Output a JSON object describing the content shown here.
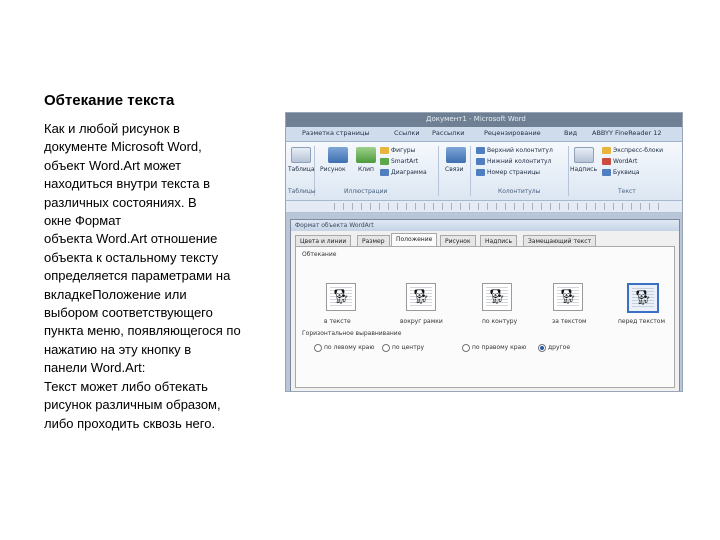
{
  "slide": {
    "title": "Обтекание текста",
    "body_lines": [
      "Как и любой рисунок в",
      "документе Microsoft Word,",
      "объект Word.Art может",
      "находиться внутри текста в",
      "различных состояниях. В",
      "окне Формат",
      "объекта Word.Art отношение",
      "объекта к остальному тексту",
      "определяется параметрами на",
      "вкладкеПоложение или",
      "выбором соответствующего",
      "пункта меню, появляющегося по",
      "нажатию на эту кнопку в",
      "панели Word.Art:",
      "Текст может либо обтекать",
      "рисунок различным образом,",
      "либо проходить сквозь него."
    ]
  },
  "screenshot": {
    "window_title": "Документ1 - Microsoft Word",
    "ribbon_tabs": [
      "Разметка страницы",
      "Ссылки",
      "Рассылки",
      "Рецензирование",
      "Вид",
      "ABBYY FineReader 12"
    ],
    "ribbon": {
      "table_label": "Таблица",
      "picture_label": "Рисунок",
      "clip_label": "Клип",
      "shapes_label": "Фигуры",
      "smartart_label": "SmartArt",
      "chart_label": "Диаграмма",
      "links_label": "Связи",
      "header_label": "Верхний колонтитул",
      "footer_label": "Нижний колонтитул",
      "pagenum_label": "Номер страницы",
      "textbox_label": "Надпись",
      "expressblocks_label": "Экспресс-блоки",
      "wordart_label": "WordArt",
      "dropcap_label": "Буквица",
      "group_tables": "Таблицы",
      "group_illustrations": "Иллюстрации",
      "group_headers": "Колонтитулы",
      "group_text": "Текст"
    },
    "dialog": {
      "title": "Формат объекта WordArt",
      "tabs": [
        "Цвета и линии",
        "Размер",
        "Положение",
        "Рисунок",
        "Надпись",
        "Замещающий текст"
      ],
      "active_tab_index": 2,
      "wrap_section": "Обтекание",
      "wrap_options": [
        "в тексте",
        "вокруг рамки",
        "по контуру",
        "за текстом",
        "перед текстом"
      ],
      "selected_wrap_index": 4,
      "align_section": "Горизонтальное выравнивание",
      "align_options": [
        "по левому краю",
        "по центру",
        "по правому краю",
        "другое"
      ],
      "selected_align_index": 3
    }
  }
}
